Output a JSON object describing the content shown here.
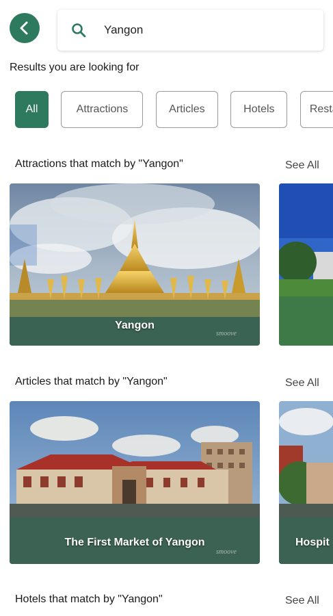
{
  "search": {
    "query": "Yangon"
  },
  "results_heading": "Results you are looking for",
  "filters": [
    "All",
    "Attractions",
    "Articles",
    "Hotels",
    "Restaurants"
  ],
  "sections": {
    "attractions": {
      "title": "Attractions that match by \"Yangon\"",
      "see_all": "See All",
      "cards": [
        {
          "label": "Yangon",
          "watermark": "smoove"
        }
      ]
    },
    "articles": {
      "title": "Articles that match by \"Yangon\"",
      "see_all": "See All",
      "cards": [
        {
          "label": "The First Market of Yangon",
          "watermark": "smoove"
        },
        {
          "label": "Hospit"
        }
      ]
    },
    "hotels": {
      "title": "Hotels that match by \"Yangon\"",
      "see_all": "See All"
    }
  },
  "colors": {
    "accent": "#2e7a5e"
  },
  "icons": {
    "back": "arrow-left-icon",
    "search": "search-icon"
  }
}
